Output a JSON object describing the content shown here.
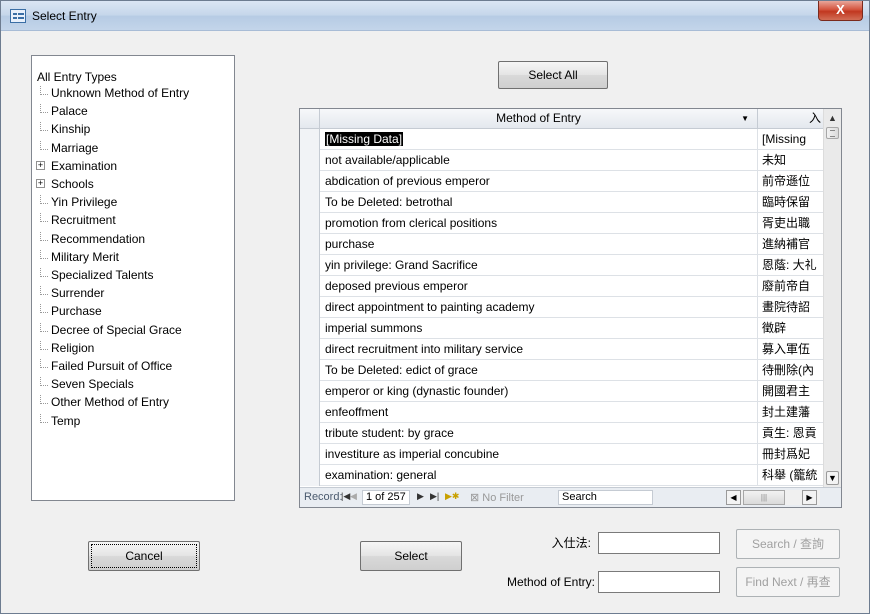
{
  "window": {
    "title": "Select Entry",
    "close_glyph": "X"
  },
  "tree": {
    "root": "All Entry Types",
    "items": [
      {
        "label": "Unknown Method of Entry",
        "expandable": false
      },
      {
        "label": "Palace",
        "expandable": false
      },
      {
        "label": "Kinship",
        "expandable": false
      },
      {
        "label": "Marriage",
        "expandable": false
      },
      {
        "label": "Examination",
        "expandable": true
      },
      {
        "label": "Schools",
        "expandable": true
      },
      {
        "label": "Yin Privilege",
        "expandable": false
      },
      {
        "label": "Recruitment",
        "expandable": false
      },
      {
        "label": "Recommendation",
        "expandable": false
      },
      {
        "label": "Military Merit",
        "expandable": false
      },
      {
        "label": "Specialized Talents",
        "expandable": false
      },
      {
        "label": "Surrender",
        "expandable": false
      },
      {
        "label": "Purchase",
        "expandable": false
      },
      {
        "label": "Decree of Special Grace",
        "expandable": false
      },
      {
        "label": "Religion",
        "expandable": false
      },
      {
        "label": "Failed Pursuit of Office",
        "expandable": false
      },
      {
        "label": "Seven Specials",
        "expandable": false
      },
      {
        "label": "Other Method of Entry",
        "expandable": false
      },
      {
        "label": "Temp",
        "expandable": false
      }
    ]
  },
  "buttons": {
    "select_all": "Select All",
    "cancel": "Cancel",
    "select": "Select",
    "search": "Search / 查詢",
    "find_next": "Find Next / 再查"
  },
  "grid": {
    "header_col1": "Method of Entry",
    "header_col2": "入",
    "rows": [
      {
        "c1": "[Missing Data]",
        "c2": "[Missing",
        "selected": true
      },
      {
        "c1": "not available/applicable",
        "c2": "未知"
      },
      {
        "c1": "abdication of previous emperor",
        "c2": "前帝遜位"
      },
      {
        "c1": "To be Deleted: betrothal",
        "c2": "臨時保留"
      },
      {
        "c1": "promotion from clerical positions",
        "c2": "胥吏出職"
      },
      {
        "c1": "purchase",
        "c2": "進納補官"
      },
      {
        "c1": "yin privilege: Grand Sacrifice",
        "c2": "恩蔭: 大礼"
      },
      {
        "c1": "deposed previous emperor",
        "c2": "廢前帝自"
      },
      {
        "c1": "direct appointment to painting academy",
        "c2": "畫院待詔"
      },
      {
        "c1": "imperial summons",
        "c2": "徵辟"
      },
      {
        "c1": "direct recruitment into military service",
        "c2": "募入軍伍"
      },
      {
        "c1": "To be Deleted: edict of grace",
        "c2": "待刪除(內"
      },
      {
        "c1": "emperor or king (dynastic founder)",
        "c2": "開國君主"
      },
      {
        "c1": "enfeoffment",
        "c2": "封土建藩"
      },
      {
        "c1": "tribute student: by grace",
        "c2": "貢生: 恩貢"
      },
      {
        "c1": "investiture as imperial concubine",
        "c2": "冊封爲妃"
      },
      {
        "c1": "examination: general",
        "c2": "科舉 (籠統"
      }
    ]
  },
  "navbar": {
    "record_label": "Record:",
    "position": "1 of 257",
    "no_filter": "No Filter",
    "search": "Search"
  },
  "fields": {
    "entry_label": "入仕法:",
    "entry_value": "",
    "method_label": "Method of Entry:",
    "method_value": ""
  }
}
